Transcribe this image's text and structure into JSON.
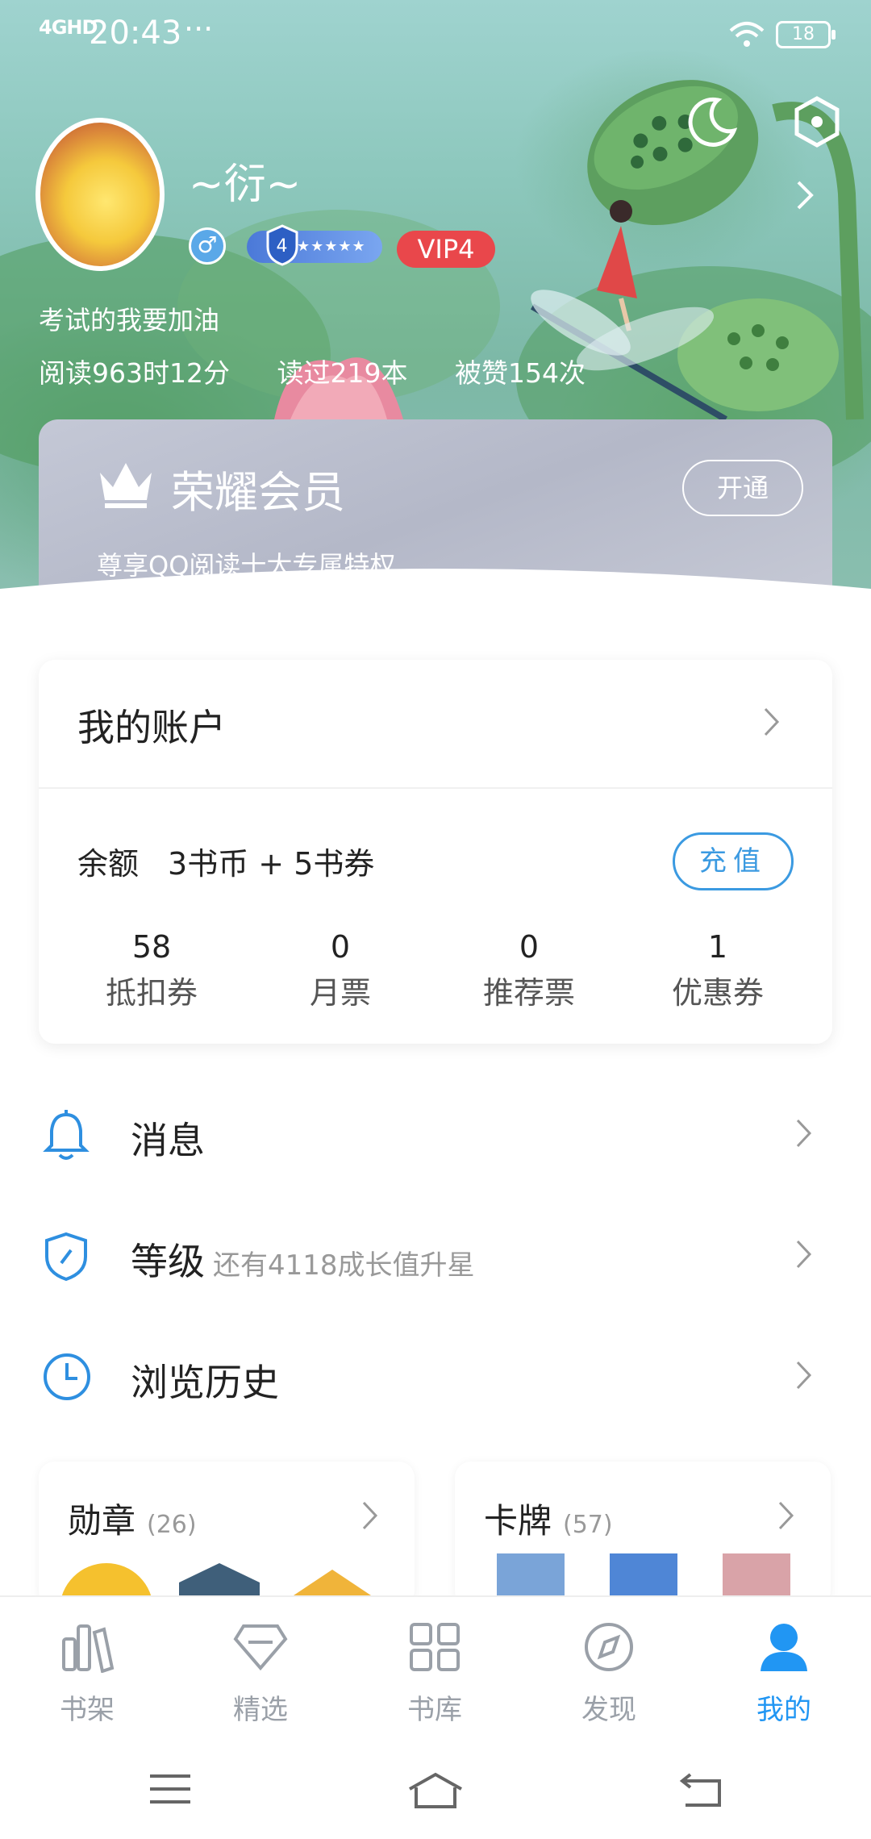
{
  "status_bar": {
    "network": "4GHD",
    "time": "20:43",
    "dots": "···",
    "battery": "18"
  },
  "profile": {
    "nickname": "~衍~",
    "gender_symbol": "♂",
    "level": "4",
    "level_stars": "★★★★★",
    "vip": "VIP4",
    "motto": "考试的我要加油",
    "stats": [
      "阅读963时12分",
      "读过219本",
      "被赞154次"
    ]
  },
  "member": {
    "title": "荣耀会员",
    "subtitle": "尊享QQ阅读十大专属特权",
    "open_label": "开通"
  },
  "account": {
    "title": "我的账户",
    "balance_label": "余额",
    "balance_value": "3书币 + 5书券",
    "recharge_label": "充值",
    "tickets": [
      {
        "num": "58",
        "label": "抵扣券"
      },
      {
        "num": "0",
        "label": "月票"
      },
      {
        "num": "0",
        "label": "推荐票"
      },
      {
        "num": "1",
        "label": "优惠券"
      }
    ]
  },
  "menu": {
    "messages": "消息",
    "level": "等级",
    "level_hint": "还有4118成长值升星",
    "history": "浏览历史"
  },
  "cards": {
    "medals_title": "勋章",
    "medals_count": "(26)",
    "cards_title": "卡牌",
    "cards_count": "(57)"
  },
  "tabs": [
    {
      "label": "书架",
      "icon": "bookshelf-icon"
    },
    {
      "label": "精选",
      "icon": "diamond-icon"
    },
    {
      "label": "书库",
      "icon": "grid-icon"
    },
    {
      "label": "发现",
      "icon": "compass-icon"
    },
    {
      "label": "我的",
      "icon": "user-icon",
      "active": true
    }
  ],
  "colors": {
    "accent": "#2196f3",
    "vip": "#e9474b",
    "recharge": "#3b9ae1"
  }
}
